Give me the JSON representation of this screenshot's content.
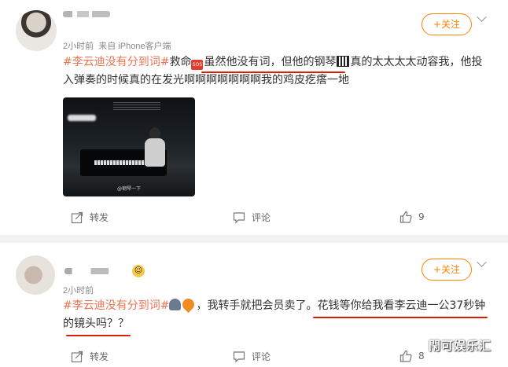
{
  "posts": [
    {
      "time": "2小时前",
      "source": "来自 iPhone客户端",
      "follow_label": "+关注",
      "tag": "#李云迪没有分到词#",
      "text_a": "救命",
      "text_b": "虽然他没有词，但他的钢琴",
      "text_c": "真的太太太太动容我，他投入弹奏的时候真的在发光啊啊啊啊啊啊啊我的鸡皮疙瘩一地",
      "media_caption": "@钢琴一下",
      "actions": {
        "share": "转发",
        "comment": "评论",
        "like_count": "9"
      }
    },
    {
      "time": "2小时前",
      "follow_label": "+关注",
      "tag": "#李云迪没有分到词#",
      "text_a": "，我转手就把会员卖了。",
      "text_b": "花钱等你给我看李云迪一公37秒钟的镜头吗？？",
      "actions": {
        "share": "转发",
        "comment": "评论",
        "like_count": "8"
      }
    }
  ],
  "watermark": "閇可娱乐汇",
  "colors": {
    "accent": "#ff8200",
    "tag": "#eb7350",
    "underline": "#d81e06"
  },
  "icons": [
    "share-icon",
    "comment-icon",
    "like-icon",
    "chevron-down-icon"
  ]
}
